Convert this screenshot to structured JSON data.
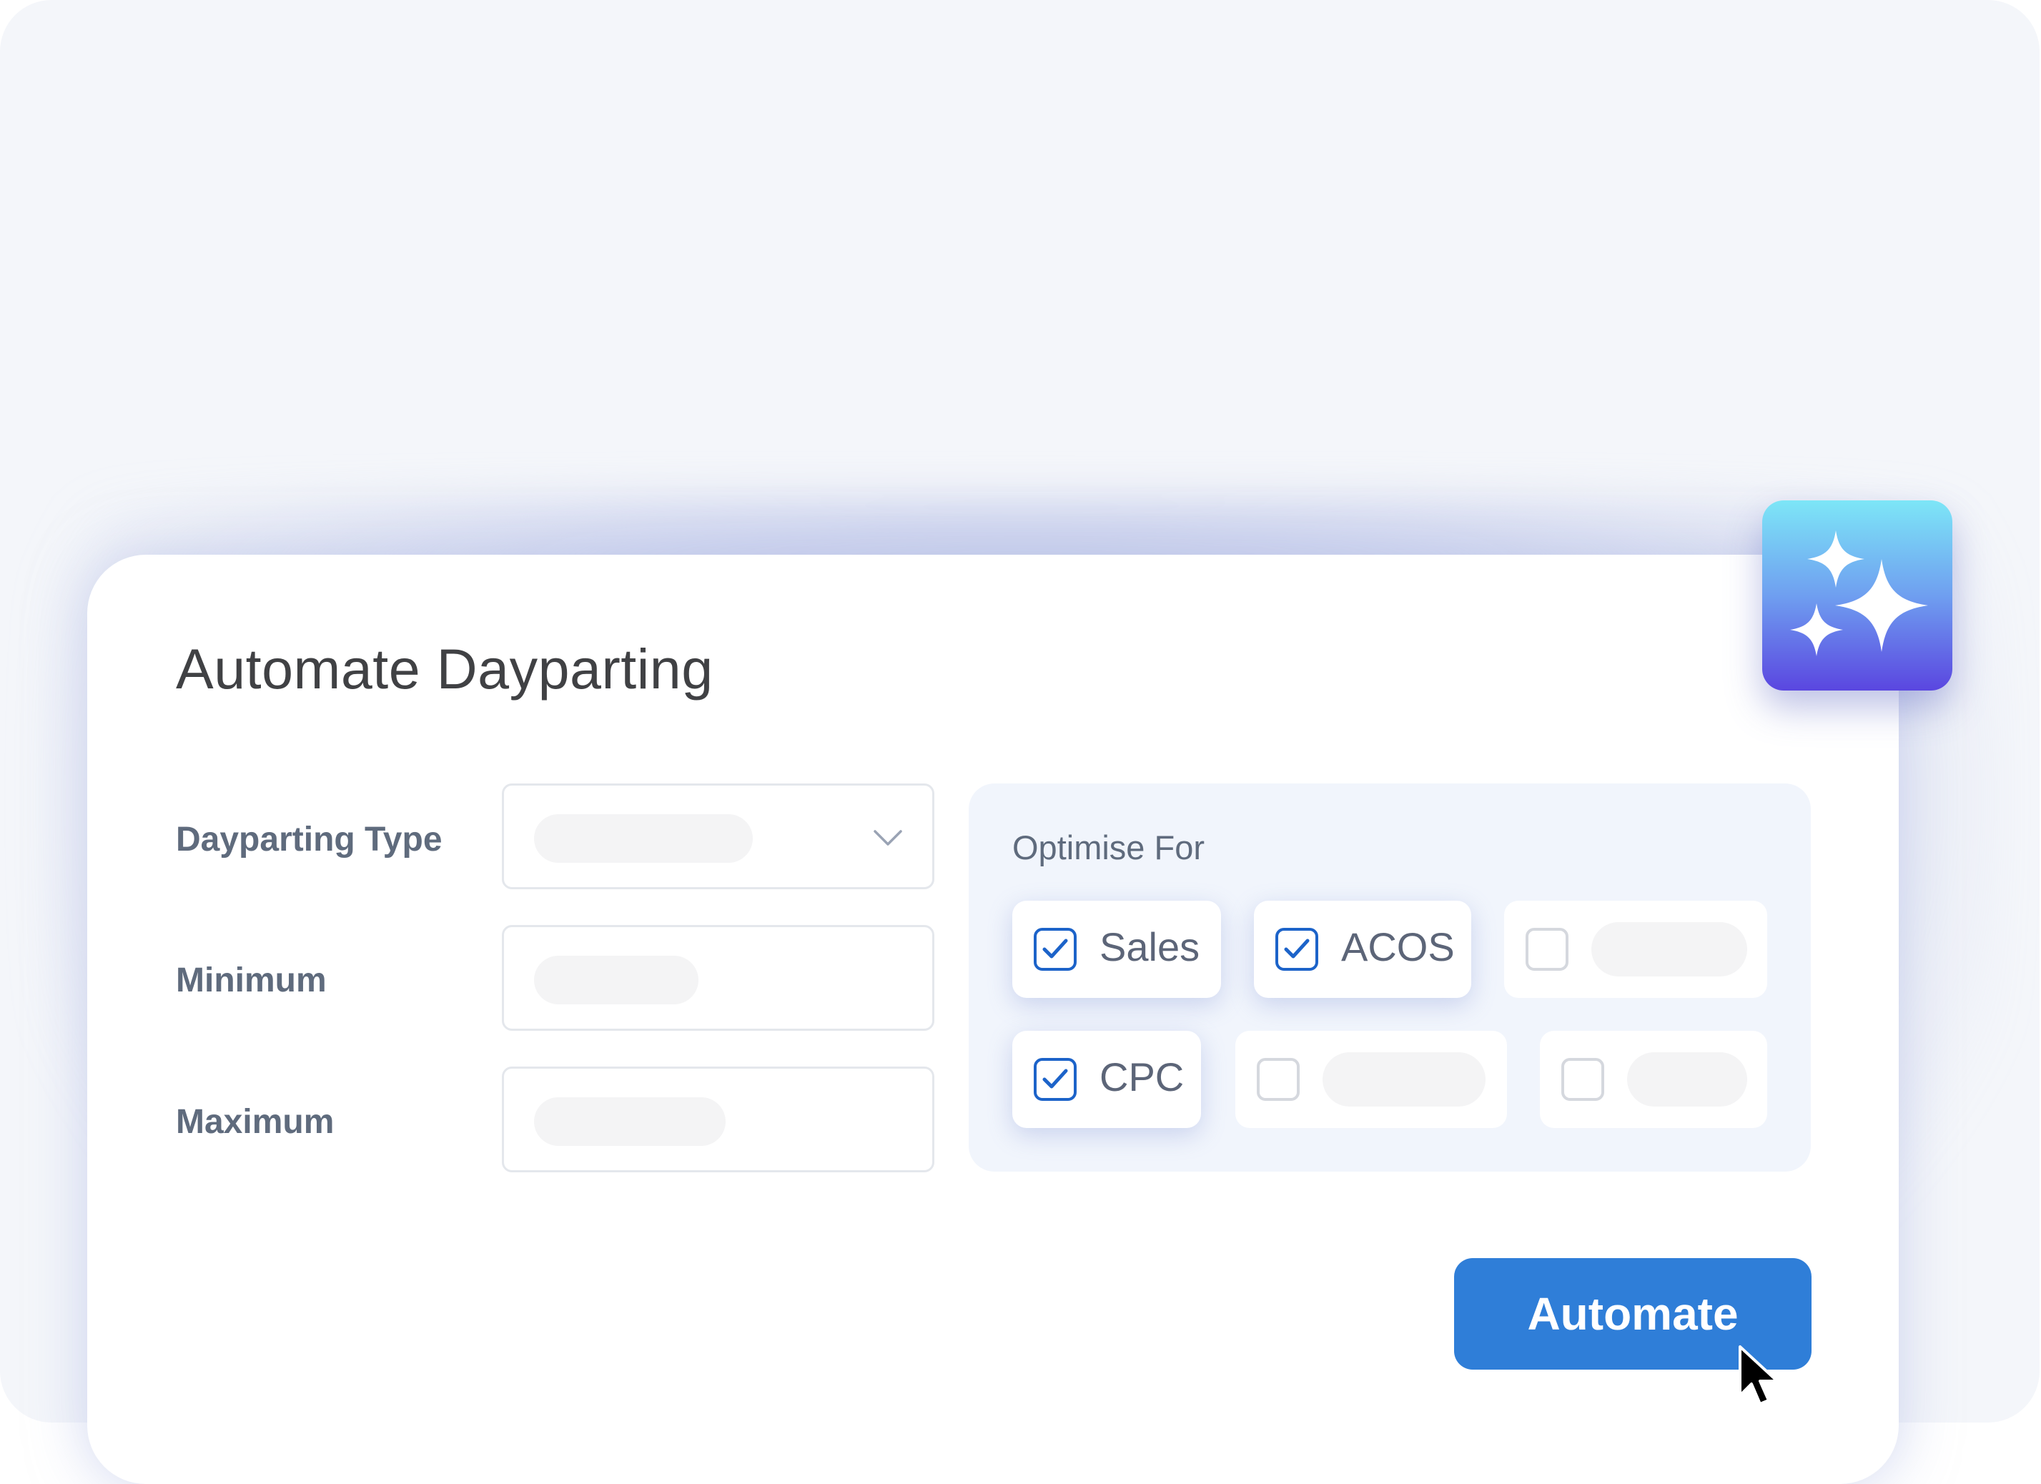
{
  "dialog": {
    "title": "Automate Dayparting"
  },
  "form": {
    "dayparting_type_label": "Dayparting Type",
    "minimum_label": "Minimum",
    "maximum_label": "Maximum"
  },
  "optimise": {
    "title": "Optimise For",
    "options": [
      {
        "label": "Sales",
        "checked": true
      },
      {
        "label": "ACOS",
        "checked": true
      },
      {
        "label": "",
        "checked": false
      },
      {
        "label": "CPC",
        "checked": true
      },
      {
        "label": "",
        "checked": false
      },
      {
        "label": "",
        "checked": false
      }
    ]
  },
  "actions": {
    "automate_label": "Automate"
  },
  "icons": {
    "ai_badge": "sparkles-icon",
    "dropdown": "chevron-down-icon",
    "checkbox": "checkmark-icon",
    "cursor": "mouse-pointer-icon"
  },
  "colors": {
    "accent": "#2f7ed8",
    "checkbox_on": "#1c63c9",
    "panel_bg": "#f1f5fc"
  }
}
